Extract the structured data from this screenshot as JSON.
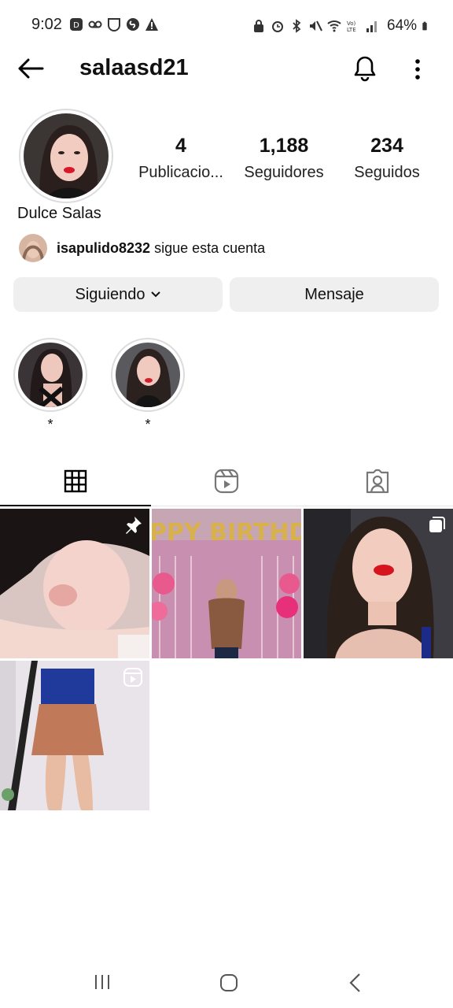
{
  "status_bar": {
    "time": "9:02",
    "battery": "64%"
  },
  "header": {
    "username": "salaasd21"
  },
  "profile": {
    "display_name": "Dulce Salas",
    "stats": [
      {
        "value": "4",
        "label": "Publicacio..."
      },
      {
        "value": "1,188",
        "label": "Seguidores"
      },
      {
        "value": "234",
        "label": "Seguidos"
      }
    ],
    "followed_by": {
      "user": "isapulido8232",
      "text": "sigue esta cuenta"
    }
  },
  "actions": {
    "following_label": "Siguiendo",
    "message_label": "Mensaje"
  },
  "highlights": [
    {
      "label": "*"
    },
    {
      "label": "*"
    }
  ],
  "grid": {
    "posts": [
      {
        "badge": "pin-icon"
      },
      {
        "badge": "",
        "balloon_text": "HAPPY BIRTHDAY"
      },
      {
        "badge": "carousel-icon"
      },
      {
        "badge": "reels-icon"
      }
    ]
  }
}
